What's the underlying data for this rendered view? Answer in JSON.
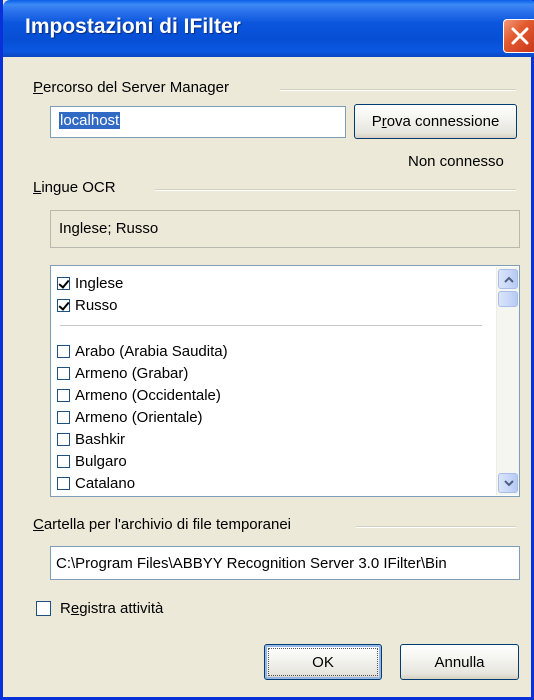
{
  "window": {
    "title": "Impostazioni di IFilter"
  },
  "server": {
    "group_label_prefix": "P",
    "group_label_rest": "ercorso del Server Manager",
    "input_value": "localhost",
    "test_button_prefix": "P",
    "test_button_ul": "r",
    "test_button_rest": "ova connessione",
    "status": "Non connesso"
  },
  "ocr": {
    "group_label_ul": "L",
    "group_label_rest": "ingue OCR",
    "selected_summary": "Inglese; Russo",
    "checked_items": [
      {
        "label": "Inglese",
        "checked": true
      },
      {
        "label": "Russo",
        "checked": true
      }
    ],
    "items": [
      {
        "label": "Arabo (Arabia Saudita)",
        "checked": false
      },
      {
        "label": "Armeno (Grabar)",
        "checked": false
      },
      {
        "label": "Armeno (Occidentale)",
        "checked": false
      },
      {
        "label": "Armeno (Orientale)",
        "checked": false
      },
      {
        "label": "Bashkir",
        "checked": false
      },
      {
        "label": "Bulgaro",
        "checked": false
      },
      {
        "label": "Catalano",
        "checked": false
      }
    ]
  },
  "temp": {
    "group_label_ul": "C",
    "group_label_rest": "artella per l'archivio di file temporanei",
    "path": "C:\\Program Files\\ABBYY Recognition Server 3.0 IFilter\\Bin"
  },
  "log": {
    "label_prefix": "R",
    "label_ul": "e",
    "label_rest": "gistra attività",
    "checked": false
  },
  "buttons": {
    "ok": "OK",
    "cancel": "Annulla"
  },
  "colors": {
    "titlebar": "#0a56dc",
    "close": "#e25a2e",
    "selection": "#316ac5",
    "dialog_bg": "#ece9d8"
  }
}
